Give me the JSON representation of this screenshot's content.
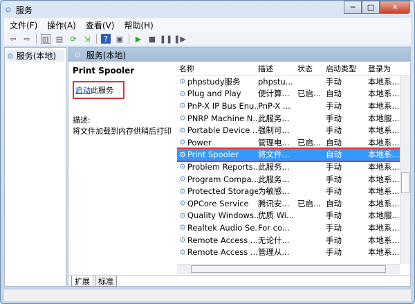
{
  "window": {
    "title": "服务",
    "minimize": "─",
    "maximize": "□",
    "close": "✕"
  },
  "menu": [
    "文件(F)",
    "操作(A)",
    "查看(V)",
    "帮助(H)"
  ],
  "tree": {
    "root": "服务(本地)"
  },
  "pane_header": "服务(本地)",
  "info": {
    "service_name": "Print Spooler",
    "start_link": "启动",
    "start_suffix": "此服务",
    "desc_label": "描述:",
    "desc_text": "将文件加载到内存供稍后打印"
  },
  "columns": [
    "名称",
    "描述",
    "状态",
    "启动类型",
    "登录为"
  ],
  "rows": [
    [
      "phpstudy服务",
      "phpstu...",
      "",
      "手动",
      "本地系..."
    ],
    [
      "Plug and Play",
      "使计算...",
      "已启...",
      "自动",
      "本地系..."
    ],
    [
      "PnP-X IP Bus Enu...",
      "PnP-X ...",
      "",
      "手动",
      "本地系..."
    ],
    [
      "PNRP Machine N...",
      "此服务...",
      "",
      "手动",
      "本地服..."
    ],
    [
      "Portable Device ...",
      "强制可...",
      "",
      "手动",
      "本地系..."
    ],
    [
      "Power",
      "管理电...",
      "已启...",
      "自动",
      "本地系..."
    ],
    [
      "Print Spooler",
      "将文件...",
      "",
      "自动",
      "本地系..."
    ],
    [
      "Problem Reports...",
      "此服务...",
      "",
      "手动",
      "本地系..."
    ],
    [
      "Program Compa...",
      "此服务...",
      "",
      "手动",
      "本地系..."
    ],
    [
      "Protected Storage",
      "为敏感...",
      "",
      "手动",
      "本地系..."
    ],
    [
      "QPCore Service",
      "腾讯安...",
      "已启...",
      "自动",
      "本地系..."
    ],
    [
      "Quality Windows...",
      "优质 Wi...",
      "",
      "手动",
      "本地服..."
    ],
    [
      "Realtek Audio Se...",
      "For co...",
      "",
      "手动",
      "本地系..."
    ],
    [
      "Remote Access ...",
      "无论什...",
      "",
      "手动",
      "本地系..."
    ],
    [
      "Remote Access ...",
      "管理从...",
      "",
      "手动",
      "本地系..."
    ]
  ],
  "selected_row": 6,
  "tabs": [
    "扩展",
    "标准"
  ]
}
